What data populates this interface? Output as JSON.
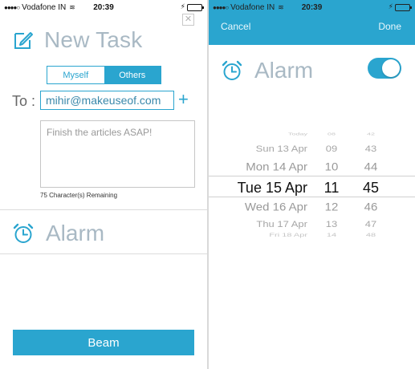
{
  "left": {
    "status": {
      "signal_dots": "●●●●○",
      "carrier": "Vodafone IN",
      "wifi_glyph": "≋",
      "time": "20:39",
      "charging_glyph": "⚡"
    },
    "close_glyph": "✕",
    "title": "New Task",
    "segments": [
      "Myself",
      "Others"
    ],
    "selected_segment": "Others",
    "to_label": "To :",
    "recipient_email": "mihir@makeuseof.com",
    "add_glyph": "+",
    "message_text": "Finish the articles ASAP!",
    "remaining_text": "75 Character(s) Remaining",
    "alarm_label": "Alarm",
    "beam_label": "Beam",
    "icons": [
      "edit-icon",
      "close-icon",
      "plus-icon",
      "alarm-clock-icon"
    ]
  },
  "right": {
    "status": {
      "signal_dots": "●●●●○",
      "carrier": "Vodafone IN",
      "wifi_glyph": "≋",
      "time": "20:39",
      "charging_glyph": "⚡"
    },
    "nav": {
      "cancel_label": "Cancel",
      "done_label": "Done"
    },
    "alarm_label": "Alarm",
    "alarm_enabled": true,
    "picker": {
      "dates": [
        "Today",
        "Sun 13 Apr",
        "Mon 14 Apr",
        "Tue 15 Apr",
        "Wed 16 Apr",
        "Thu 17 Apr",
        "Fri 18 Apr"
      ],
      "hours": [
        "08",
        "09",
        "10",
        "11",
        "12",
        "13",
        "14"
      ],
      "minutes": [
        "42",
        "43",
        "44",
        "45",
        "46",
        "47",
        "48"
      ],
      "selected": {
        "date": "Tue 15 Apr",
        "hour": "11",
        "minute": "45"
      }
    },
    "icons": [
      "alarm-clock-icon",
      "toggle-switch"
    ]
  },
  "colors": {
    "accent": "#2aa5cf",
    "title_gray": "#a9b9c4",
    "battery_green": "#4cd964",
    "divider": "#dcdcdc"
  }
}
